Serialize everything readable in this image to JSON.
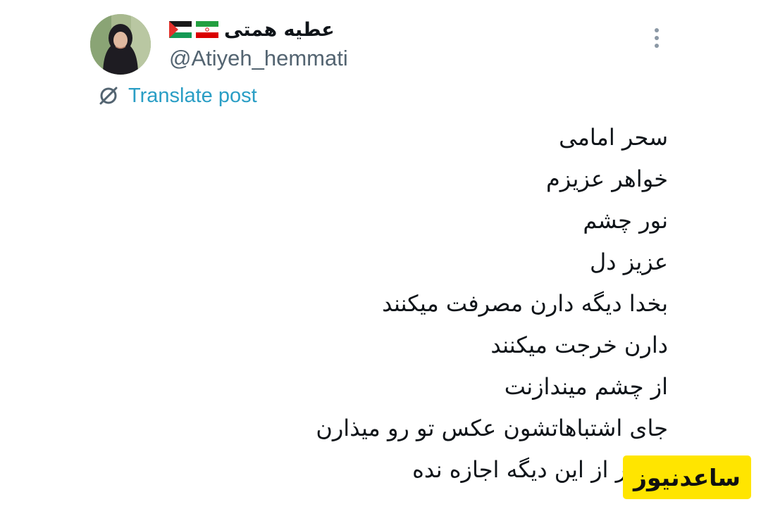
{
  "author": {
    "display_name": "عطیه همتی",
    "handle": "@Atiyeh_hemmati",
    "avatar_icon": "profile-photo",
    "flags": [
      "iran-flag",
      "palestine-flag"
    ]
  },
  "actions": {
    "more_icon": "more-vertical-icon",
    "translate_icon": "translate-icon",
    "translate_label": "Translate post"
  },
  "tweet": {
    "lines": [
      "سحر امامی",
      "خواهر عزیزم",
      "نور چشم",
      "عزیز دل",
      "بخدا دیگه دارن مصرفت میکنند",
      "دارن خرجت میکنند",
      "از چشم میندازنت",
      "جای اشتباهاتشون عکس تو رو میذارن",
      "بیشتر از این دیگه اجازه نده"
    ]
  },
  "watermark": {
    "text": "ساعدنیوز",
    "background": "#ffe500"
  },
  "colors": {
    "text": "#0f1419",
    "handle": "#536471",
    "link": "#2a9ec5"
  }
}
